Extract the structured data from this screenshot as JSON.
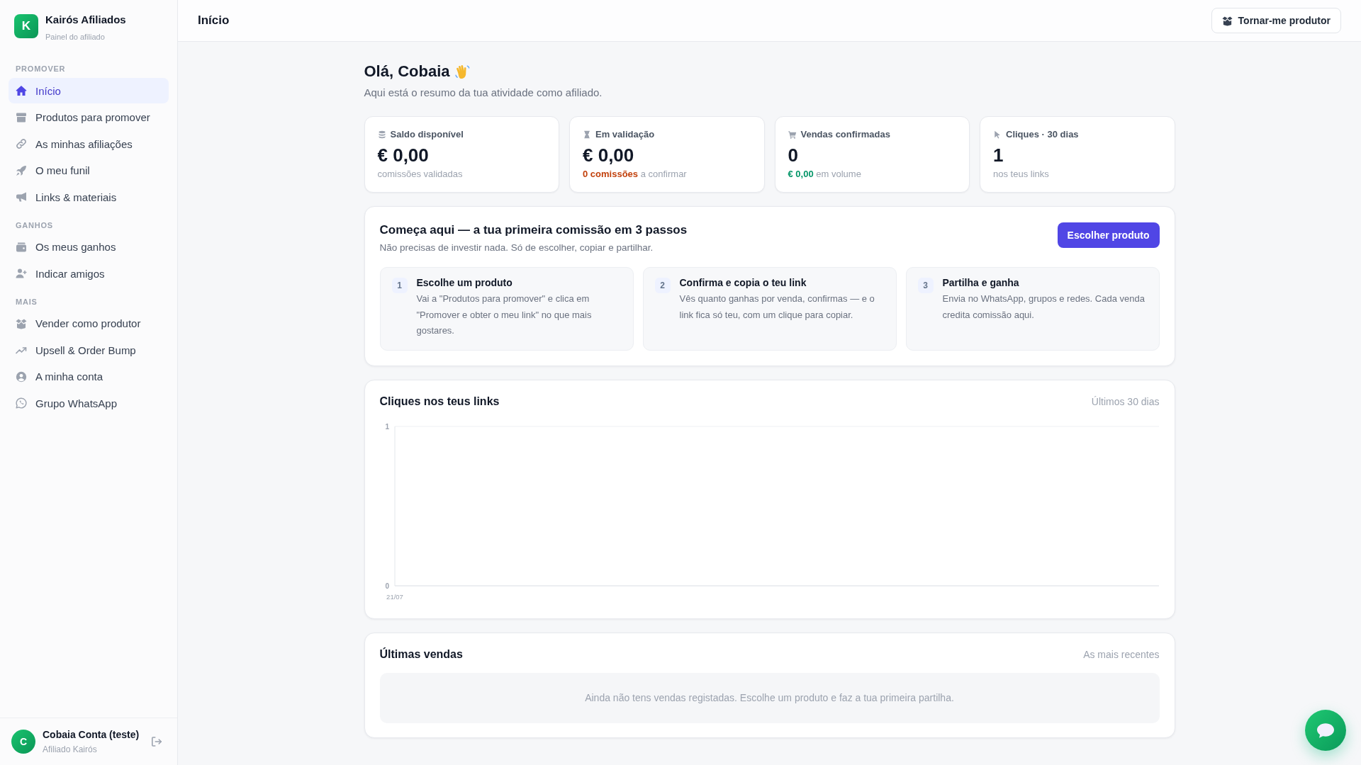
{
  "sidebar": {
    "brand": {
      "logo": "K",
      "name": "Kairós Afiliados",
      "subtitle": "Painel do afiliado"
    },
    "sections": [
      {
        "title": "PROMOVER",
        "items": [
          {
            "label": "Início",
            "selected": true
          },
          {
            "label": "Produtos para promover",
            "selected": false
          },
          {
            "label": "As minhas afiliações",
            "selected": false
          },
          {
            "label": "O meu funil",
            "selected": false
          },
          {
            "label": "Links & materiais",
            "selected": false
          }
        ]
      },
      {
        "title": "GANHOS",
        "items": [
          {
            "label": "Os meus ganhos",
            "selected": false
          },
          {
            "label": "Indicar amigos",
            "selected": false
          }
        ]
      },
      {
        "title": "MAIS",
        "items": [
          {
            "label": "Vender como produtor",
            "selected": false
          },
          {
            "label": "Upsell & Order Bump",
            "selected": false
          },
          {
            "label": "A minha conta",
            "selected": false
          },
          {
            "label": "Grupo WhatsApp",
            "selected": false
          }
        ]
      }
    ],
    "user": {
      "avatar": "C",
      "name": "Cobaia Conta (teste)",
      "role": "Afiliado Kairós"
    }
  },
  "header": {
    "title": "Início",
    "button": "Tornar-me produtor"
  },
  "greeting": {
    "title": "Olá, Cobaia",
    "subtitle": "Aqui está o resumo da tua atividade como afiliado."
  },
  "stats": [
    {
      "label": "Saldo disponível",
      "value": "€ 0,00",
      "note": "comissões validadas"
    },
    {
      "label": "Em validação",
      "value": "€ 0,00",
      "highlight": {
        "text": "0 comissões",
        "color": "#c2410c"
      },
      "note": "a confirmar"
    },
    {
      "label": "Vendas confirmadas",
      "value": "0",
      "highlight": {
        "text": "€ 0,00",
        "color": "#059669"
      },
      "note": "em volume"
    },
    {
      "label": "Cliques · 30 dias",
      "value": "1",
      "note": "nos teus links"
    }
  ],
  "getting_started": {
    "title": "Começa aqui — a tua primeira comissão em 3 passos",
    "subtitle": "Não precisas de investir nada. Só de escolher, copiar e partilhar.",
    "button": "Escolher produto",
    "steps": [
      {
        "number": "1",
        "title": "Escolhe um produto",
        "text": "Vai a \"Produtos para promover\" e clica em \"Promover e obter o meu link\" no que mais gostares."
      },
      {
        "number": "2",
        "title": "Confirma e copia o teu link",
        "text": "Vês quanto ganhas por venda, confirmas — e o link fica só teu, com um clique para copiar."
      },
      {
        "number": "3",
        "title": "Partilha e ganha",
        "text": "Envia no WhatsApp, grupos e redes. Cada venda credita comissão aqui."
      }
    ]
  },
  "clicks_chart": {
    "title": "Cliques nos teus links",
    "period": "Últimos 30 dias",
    "chart_data": {
      "type": "line",
      "categories": [
        "21/07"
      ],
      "ylim": [
        0,
        1
      ],
      "yticks": [
        0,
        1
      ]
    }
  },
  "recent_sales": {
    "title": "Últimas vendas",
    "subtitle": "As mais recentes",
    "empty_message": "Ainda não tens vendas registadas. Escolhe um produto e faz a tua primeira partilha."
  }
}
